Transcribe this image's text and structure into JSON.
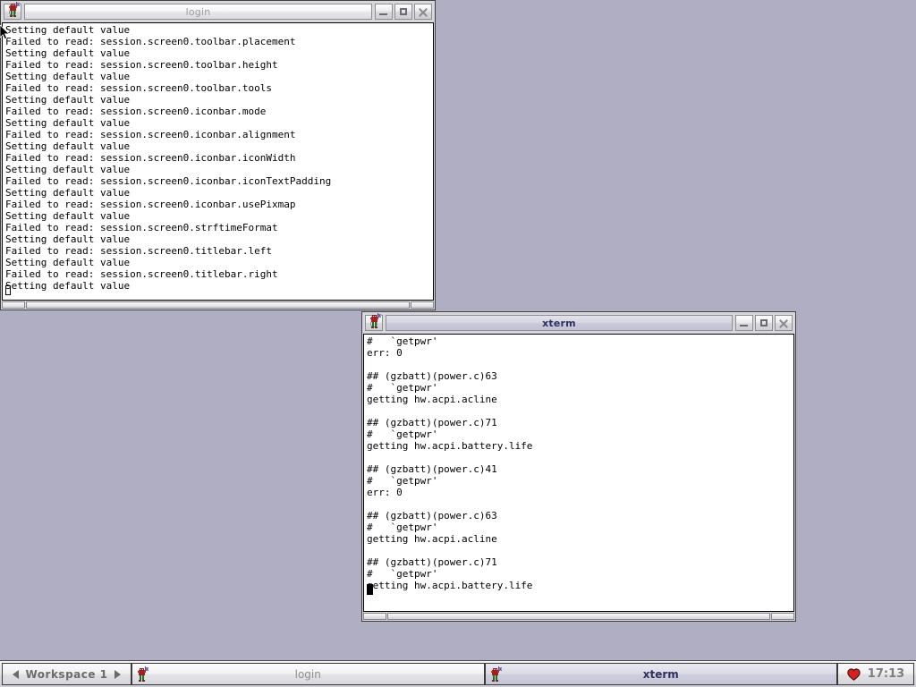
{
  "desktop": {
    "background_color": "#b0aec2"
  },
  "windows": [
    {
      "id": "login",
      "title": "login",
      "focused": false,
      "icon": "x-mascot-icon",
      "buttons": {
        "menu": "window-menu-button",
        "minimize": "minimize-button",
        "maximize": "maximize-button",
        "close": "close-button"
      },
      "terminal_text": "Setting default value\nFailed to read: session.screen0.toolbar.placement\nSetting default value\nFailed to read: session.screen0.toolbar.height\nSetting default value\nFailed to read: session.screen0.toolbar.tools\nSetting default value\nFailed to read: session.screen0.iconbar.mode\nSetting default value\nFailed to read: session.screen0.iconbar.alignment\nSetting default value\nFailed to read: session.screen0.iconbar.iconWidth\nSetting default value\nFailed to read: session.screen0.iconbar.iconTextPadding\nSetting default value\nFailed to read: session.screen0.iconbar.usePixmap\nSetting default value\nFailed to read: session.screen0.strftimeFormat\nSetting default value\nFailed to read: session.screen0.titlebar.left\nSetting default value\nFailed to read: session.screen0.titlebar.right\nSetting default value\n"
    },
    {
      "id": "xterm",
      "title": "xterm",
      "focused": true,
      "icon": "x-mascot-icon",
      "buttons": {
        "menu": "window-menu-button",
        "minimize": "minimize-button",
        "maximize": "maximize-button",
        "close": "close-button"
      },
      "terminal_text": "#   `getpwr'\nerr: 0\n\n## (gzbatt)(power.c)63\n#   `getpwr'\ngetting hw.acpi.acline\n\n## (gzbatt)(power.c)71\n#   `getpwr'\ngetting hw.acpi.battery.life\n\n## (gzbatt)(power.c)41\n#   `getpwr'\nerr: 0\n\n## (gzbatt)(power.c)63\n#   `getpwr'\ngetting hw.acpi.acline\n\n## (gzbatt)(power.c)71\n#   `getpwr'\ngetting hw.acpi.battery.life\n"
    }
  ],
  "taskbar": {
    "workspace_label": "Workspace 1",
    "prev_workspace_icon": "arrow-left-icon",
    "next_workspace_icon": "arrow-right-icon",
    "items": [
      {
        "label": "login",
        "active": false,
        "icon": "x-mascot-icon"
      },
      {
        "label": "xterm",
        "active": true,
        "icon": "x-mascot-icon"
      }
    ],
    "tray": {
      "heart_icon": "heart-icon",
      "heart_color": "#d42020",
      "clock": "17:13"
    }
  }
}
